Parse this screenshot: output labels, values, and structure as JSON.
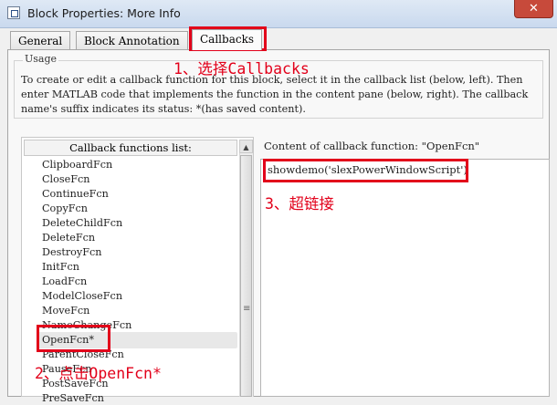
{
  "window": {
    "title": "Block Properties: More Info",
    "close_symbol": "✕"
  },
  "tabs": [
    {
      "label": "General"
    },
    {
      "label": "Block Annotation"
    },
    {
      "label": "Callbacks"
    }
  ],
  "usage": {
    "legend": "Usage",
    "text": "To create or edit a callback function for this block, select it in the callback list (below, left). Then enter MATLAB code that implements the function in the content pane (below, right). The callback name's suffix indicates its status: *(has saved content)."
  },
  "callback_list": {
    "header": "Callback functions list:",
    "items": [
      "ClipboardFcn",
      "CloseFcn",
      "ContinueFcn",
      "CopyFcn",
      "DeleteChildFcn",
      "DeleteFcn",
      "DestroyFcn",
      "InitFcn",
      "LoadFcn",
      "ModelCloseFcn",
      "MoveFcn",
      "NameChangeFcn",
      "OpenFcn*",
      "ParentCloseFcn",
      "PauseFcn",
      "PostSaveFcn",
      "PreSaveFcn"
    ],
    "selected_index": 12
  },
  "content": {
    "label": "Content of callback function: \"OpenFcn\"",
    "code": "showdemo('slexPowerWindowScript')"
  },
  "annotations": [
    {
      "text": "1、选择Callbacks"
    },
    {
      "text": "2、点击OpenFcn*"
    },
    {
      "text": "3、超链接"
    }
  ],
  "colors": {
    "annotation": "#e2001a",
    "titlebar": "#c9d9ee",
    "close_button": "#c74a3b"
  }
}
